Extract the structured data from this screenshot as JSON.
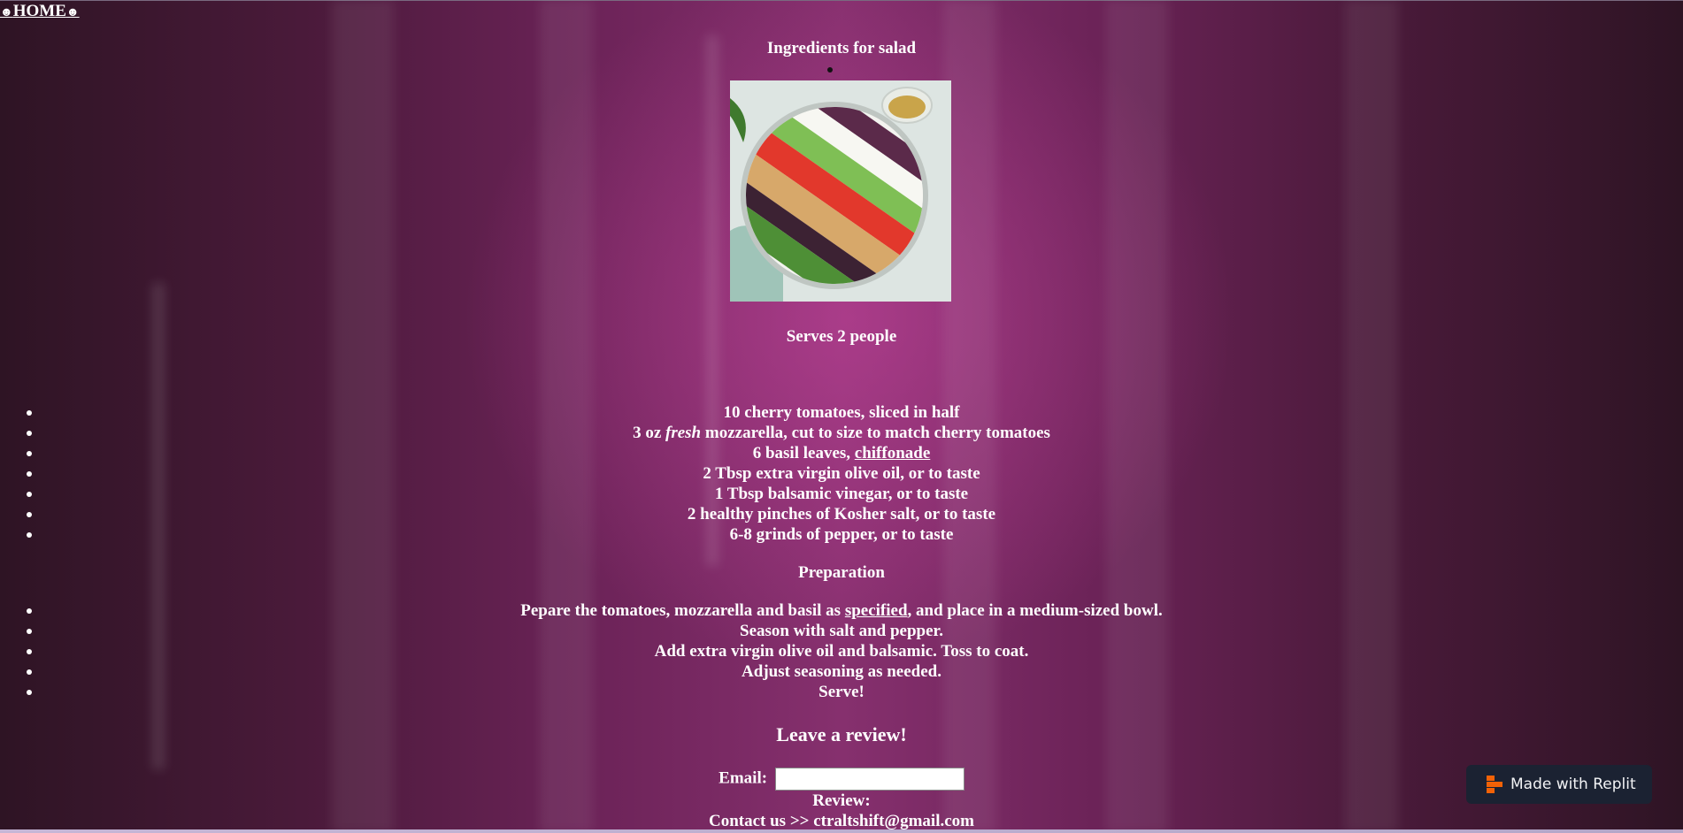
{
  "nav": {
    "home_label": "HOME",
    "face_glyph": "☻"
  },
  "recipe": {
    "title": "Ingredients for salad",
    "image_alt": "salad photo",
    "serves": "Serves 2 people",
    "ingredients": [
      {
        "text": "10 cherry tomatoes, sliced in half"
      },
      {
        "pre": "3 oz ",
        "em": "fresh",
        "post": " mozzarella, cut to size to match cherry tomatoes"
      },
      {
        "pre": "6 basil leaves, ",
        "link": "chiffonade",
        "post": ""
      },
      {
        "text": "2 Tbsp extra virgin olive oil, or to taste"
      },
      {
        "text": "1 Tbsp balsamic vinegar, or to taste"
      },
      {
        "text": "2 healthy pinches of Kosher salt, or to taste"
      },
      {
        "text": "6-8 grinds of pepper, or to taste"
      }
    ],
    "preparation_title": "Preparation",
    "preparation": [
      {
        "pre": "Pepare the tomatoes, mozzarella and basil as ",
        "link": "specified",
        "post": ", and place in a medium-sized bowl."
      },
      {
        "text": "Season with salt and pepper."
      },
      {
        "text": "Add extra virgin olive oil and balsamic. Toss to coat."
      },
      {
        "text": "Adjust seasoning as needed."
      },
      {
        "text": "Serve!"
      }
    ]
  },
  "review": {
    "title": "Leave a review!",
    "email_label": "Email:",
    "email_value": "",
    "review_label": "Review:"
  },
  "contact": {
    "text": "Contact us >> ctraltshift@gmail.com"
  },
  "badge": {
    "label": "Made with Replit",
    "icon": "replit-logo-icon",
    "color": "#f26207"
  }
}
